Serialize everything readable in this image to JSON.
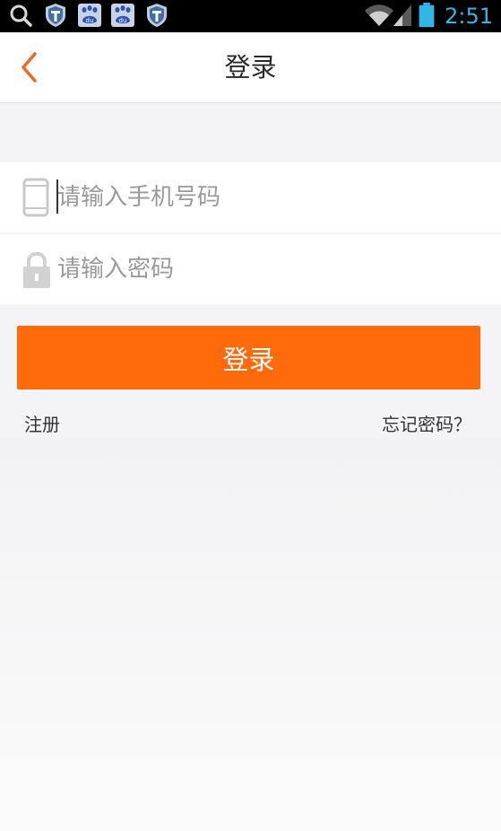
{
  "status_bar": {
    "time": "2:51",
    "icons": [
      "search-icon",
      "shield-icon",
      "baidu-paw-icon",
      "baidu-paw-icon",
      "shield-icon",
      "wifi-icon",
      "signal-icon",
      "battery-icon"
    ],
    "accent_color": "#33b5e5"
  },
  "header": {
    "title": "登录",
    "back_icon": "chevron-left-icon",
    "accent_color": "#f26522"
  },
  "form": {
    "phone": {
      "icon": "mobile-phone-icon",
      "placeholder": "请输入手机号码",
      "value": ""
    },
    "password": {
      "icon": "lock-icon",
      "placeholder": "请输入密码",
      "value": ""
    },
    "login_button": {
      "label": "登录",
      "color": "#ff6a0a"
    }
  },
  "links": {
    "register": "注册",
    "forgot_password": "忘记密码？"
  }
}
